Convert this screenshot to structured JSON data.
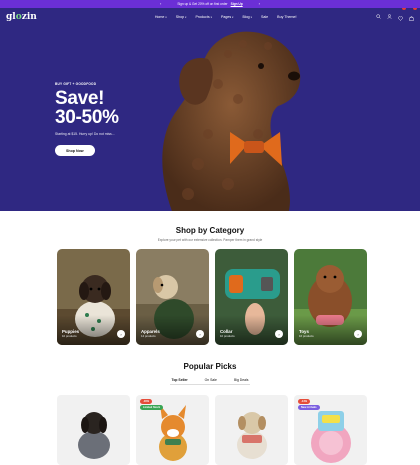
{
  "announcement": {
    "text": "Sign up & Get 20% off on first order",
    "link": "Sign Up"
  },
  "nav": {
    "logo_prefix": "gl",
    "logo_o": "o",
    "logo_suffix": "zin",
    "items": [
      "Home",
      "Shop",
      "Products",
      "Pages",
      "Blog",
      "Sale",
      "Buy Theme!"
    ],
    "cart_count": "0",
    "wishlist_count": "0"
  },
  "hero": {
    "eyebrow": "BUY GIFT + GOODFOOD",
    "title_line1": "Save!",
    "title_line2": "30-50%",
    "subtitle": "Starting at $15. Hurry up! Do not miss...",
    "button": "Shop Now"
  },
  "categories": {
    "title": "Shop by Category",
    "subtitle": "Explore your pet with our extensive collection. Pamper them in grand style",
    "items": [
      {
        "name": "Puppies",
        "sub": "10 products"
      },
      {
        "name": "Apparels",
        "sub": "14 products"
      },
      {
        "name": "Collar",
        "sub": "10 products"
      },
      {
        "name": "Toys",
        "sub": "16 products"
      }
    ]
  },
  "popular": {
    "title": "Popular Picks",
    "tabs": [
      "Top Seller",
      "On Sale",
      "Big Deals"
    ],
    "products": [
      {
        "badges": []
      },
      {
        "badges": [
          "-16%",
          "Limited Stock"
        ]
      },
      {
        "badges": []
      },
      {
        "badges": [
          "-14%",
          "New Arrivals"
        ]
      }
    ]
  },
  "colors": {
    "hero_bg": "#2f2882",
    "announce_bg": "#6b2fd6",
    "accent_green": "#7bdc85"
  }
}
